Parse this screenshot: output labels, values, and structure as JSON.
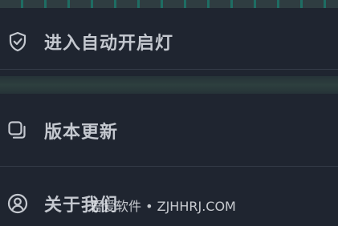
{
  "menu": {
    "items": [
      {
        "label": "进入自动开启灯",
        "icon": "shield-check-icon"
      },
      {
        "label": "版本更新",
        "icon": "layers-icon"
      },
      {
        "label": "关于我们",
        "icon": "user-circle-icon"
      }
    ]
  },
  "watermark": {
    "text": "吾爱软件 • ZJHHRJ.COM"
  },
  "colors": {
    "background": "#1f2530",
    "label": "#c4c8cf",
    "accent_strip": "#1e6d63"
  }
}
